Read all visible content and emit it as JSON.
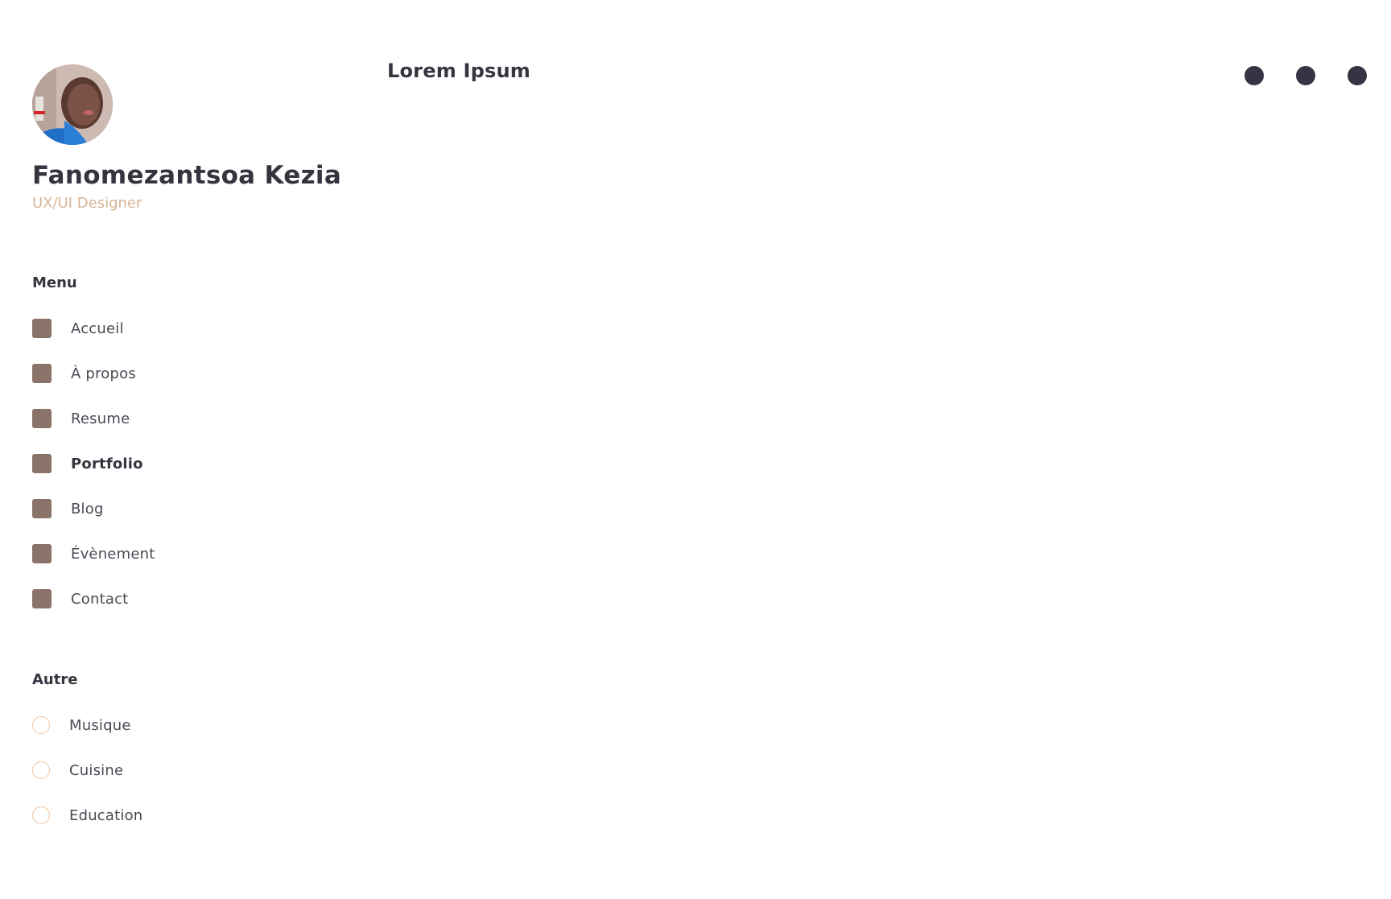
{
  "profile": {
    "name": "Fanomezantsoa Kezia",
    "role": "UX/UI Designer"
  },
  "header": {
    "title": "Lorem Ipsum"
  },
  "menu": {
    "title": "Menu",
    "items": [
      {
        "label": "Accueil",
        "icon": "square-icon"
      },
      {
        "label": "À propos",
        "icon": "square-icon"
      },
      {
        "label": "Resume",
        "icon": "square-icon"
      },
      {
        "label": "Portfolio",
        "icon": "square-icon",
        "active": true
      },
      {
        "label": "Blog",
        "icon": "square-icon"
      },
      {
        "label": "Évènement",
        "icon": "square-icon"
      },
      {
        "label": "Contact",
        "icon": "square-icon"
      }
    ]
  },
  "autre": {
    "title": "Autre",
    "items": [
      {
        "label": "Musique",
        "icon": "circle-icon"
      },
      {
        "label": "Cuisine",
        "icon": "circle-icon"
      },
      {
        "label": "Education",
        "icon": "circle-icon"
      }
    ]
  },
  "window_controls": [
    "dot-icon",
    "dot-icon",
    "dot-icon"
  ],
  "colors": {
    "text_dark": "#353540",
    "accent_role": "#d8b596",
    "menu_square": "#8a7469",
    "autre_circle_border": "#f2c39b",
    "window_dot": "#343442"
  }
}
